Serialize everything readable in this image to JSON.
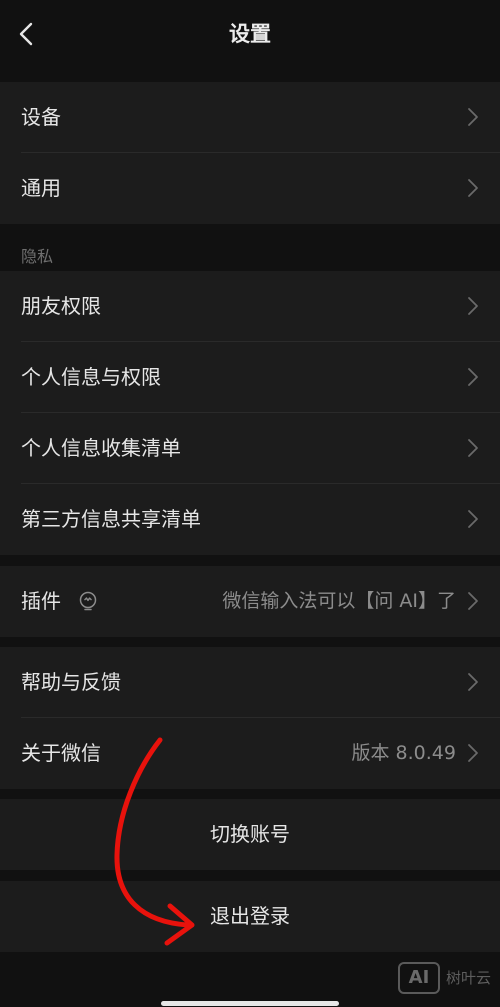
{
  "nav": {
    "title": "设置",
    "back_icon": "chevron-left-icon"
  },
  "groups": {
    "device_general": {
      "device": "设备",
      "general": "通用"
    },
    "privacy": {
      "section_label": "隐私",
      "friend_permissions": "朋友权限",
      "personal_info_permissions": "个人信息与权限",
      "personal_info_list": "个人信息收集清单",
      "third_party_list": "第三方信息共享清单"
    },
    "plugins": {
      "label": "插件",
      "icon": "lightbulb-icon",
      "value": "微信输入法可以【问 AI】了"
    },
    "help_about": {
      "help": "帮助与反馈",
      "about": "关于微信",
      "version": "版本 8.0.49"
    },
    "account": {
      "switch_account": "切换账号",
      "logout": "退出登录"
    }
  },
  "watermark": {
    "logo": "AI",
    "text": "树叶云"
  },
  "colors": {
    "background": "#111111",
    "row_background": "#1c1c1c",
    "primary_text": "#e6e6e6",
    "secondary_text": "#8c8c8c",
    "annotation_red": "#e8120c"
  }
}
